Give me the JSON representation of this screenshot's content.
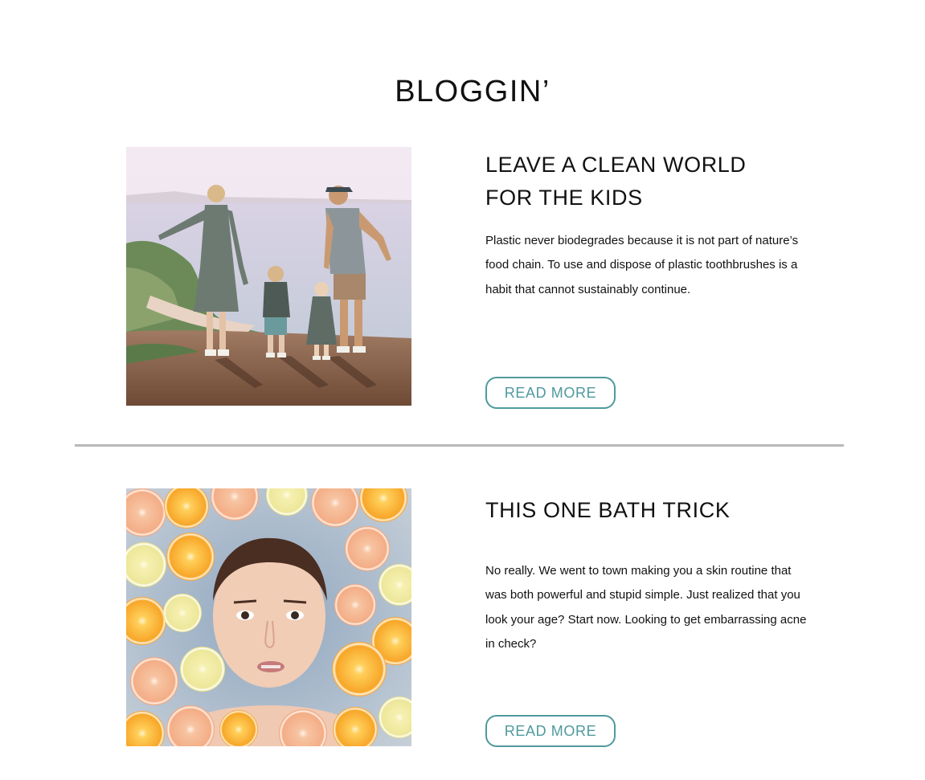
{
  "page": {
    "title": "BLOGGIN’"
  },
  "posts": [
    {
      "title_line1": "LEAVE A CLEAN WORLD",
      "title_line2": "FOR THE KIDS",
      "excerpt": "Plastic never biodegrades because it is not part of nature’s food chain. To use and dispose of plastic toothbrushes is a habit that cannot sustainably continue.",
      "button_label": "READ MORE",
      "image_subject": "family-on-cliff-photo"
    },
    {
      "title_line1": "THIS ONE BATH TRICK",
      "title_line2": "",
      "excerpt": "No really. We went to town making you a skin routine that was both powerful and stupid simple. Just realized that you look your age? Start now. Looking to get embarrassing acne in check?",
      "button_label": "READ MORE",
      "image_subject": "citrus-bath-face-photo"
    }
  ],
  "colors": {
    "accent": "#4f9a9d",
    "divider": "#b8b8b8",
    "text": "#111111"
  }
}
